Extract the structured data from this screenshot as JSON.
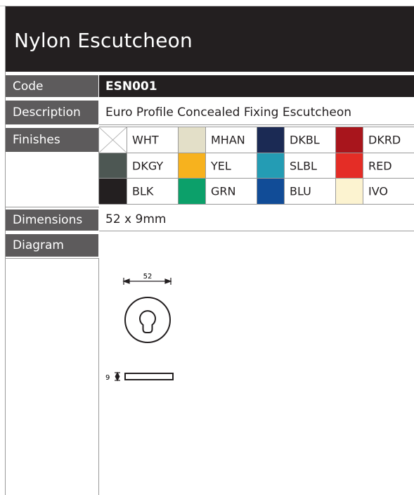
{
  "header": {
    "title": "Nylon Escutcheon"
  },
  "rows": {
    "code": {
      "label": "Code",
      "value": "ESN001"
    },
    "description": {
      "label": "Description",
      "value": "Euro Profile Concealed Fixing Escutcheon"
    },
    "finishes": {
      "label": "Finishes"
    },
    "dimensions": {
      "label": "Dimensions",
      "value": "52  x 9mm"
    },
    "diagram": {
      "label": "Diagram"
    }
  },
  "finishes": [
    {
      "name": "WHT",
      "color": "#ffffff"
    },
    {
      "name": "MHAN",
      "color": "#e3dfc8"
    },
    {
      "name": "DKBL",
      "color": "#1b2a54"
    },
    {
      "name": "DKRD",
      "color": "#a8151c"
    },
    {
      "name": "DKGY",
      "color": "#4d5753"
    },
    {
      "name": "YEL",
      "color": "#f7b21e"
    },
    {
      "name": "SLBL",
      "color": "#249cb4"
    },
    {
      "name": "RED",
      "color": "#e42d26"
    },
    {
      "name": "BLK",
      "color": "#231f20"
    },
    {
      "name": "GRN",
      "color": "#0ca06a"
    },
    {
      "name": "BLU",
      "color": "#114c97"
    },
    {
      "name": "IVO",
      "color": "#fcf3d0"
    }
  ],
  "diagram": {
    "width_label": "52",
    "depth_label": "9"
  }
}
